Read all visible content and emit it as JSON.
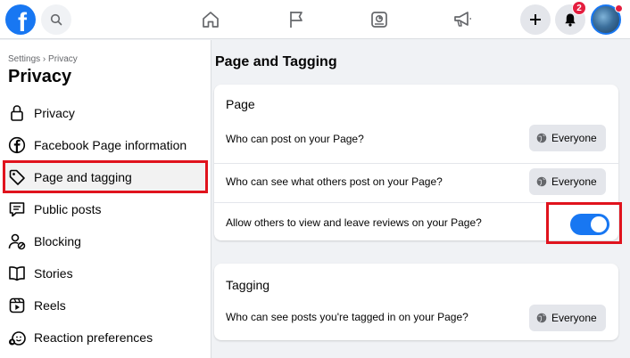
{
  "topbar": {
    "logo_letter": "f",
    "notifications_count": "2",
    "icons": [
      "facebook-logo",
      "search-icon",
      "home-icon",
      "flag-icon",
      "ads-manager-icon",
      "megaphone-icon",
      "plus-icon",
      "bell-icon",
      "avatar"
    ]
  },
  "sidebar": {
    "breadcrumb": "Settings › Privacy",
    "title": "Privacy",
    "items": [
      {
        "label": "Privacy",
        "icon": "lock-icon"
      },
      {
        "label": "Facebook Page information",
        "icon": "facebook-icon"
      },
      {
        "label": "Page and tagging",
        "icon": "tag-icon",
        "active": true
      },
      {
        "label": "Public posts",
        "icon": "public-posts-icon"
      },
      {
        "label": "Blocking",
        "icon": "blocking-icon"
      },
      {
        "label": "Stories",
        "icon": "book-icon"
      },
      {
        "label": "Reels",
        "icon": "reels-icon"
      },
      {
        "label": "Reaction preferences",
        "icon": "reaction-icon"
      }
    ]
  },
  "main": {
    "title": "Page and Tagging",
    "page_card": {
      "title": "Page",
      "rows": [
        {
          "label": "Who can post on your Page?",
          "value": "Everyone"
        },
        {
          "label": "Who can see what others post on your Page?",
          "value": "Everyone"
        },
        {
          "label": "Allow others to view and leave reviews on your Page?",
          "toggle_on": true
        }
      ]
    },
    "tagging_card": {
      "title": "Tagging",
      "rows": [
        {
          "label": "Who can see posts you're tagged in on your Page?",
          "value": "Everyone"
        }
      ]
    }
  },
  "colors": {
    "brand": "#1877f2",
    "highlight": "#e0131d",
    "badge": "#e41e3f"
  }
}
